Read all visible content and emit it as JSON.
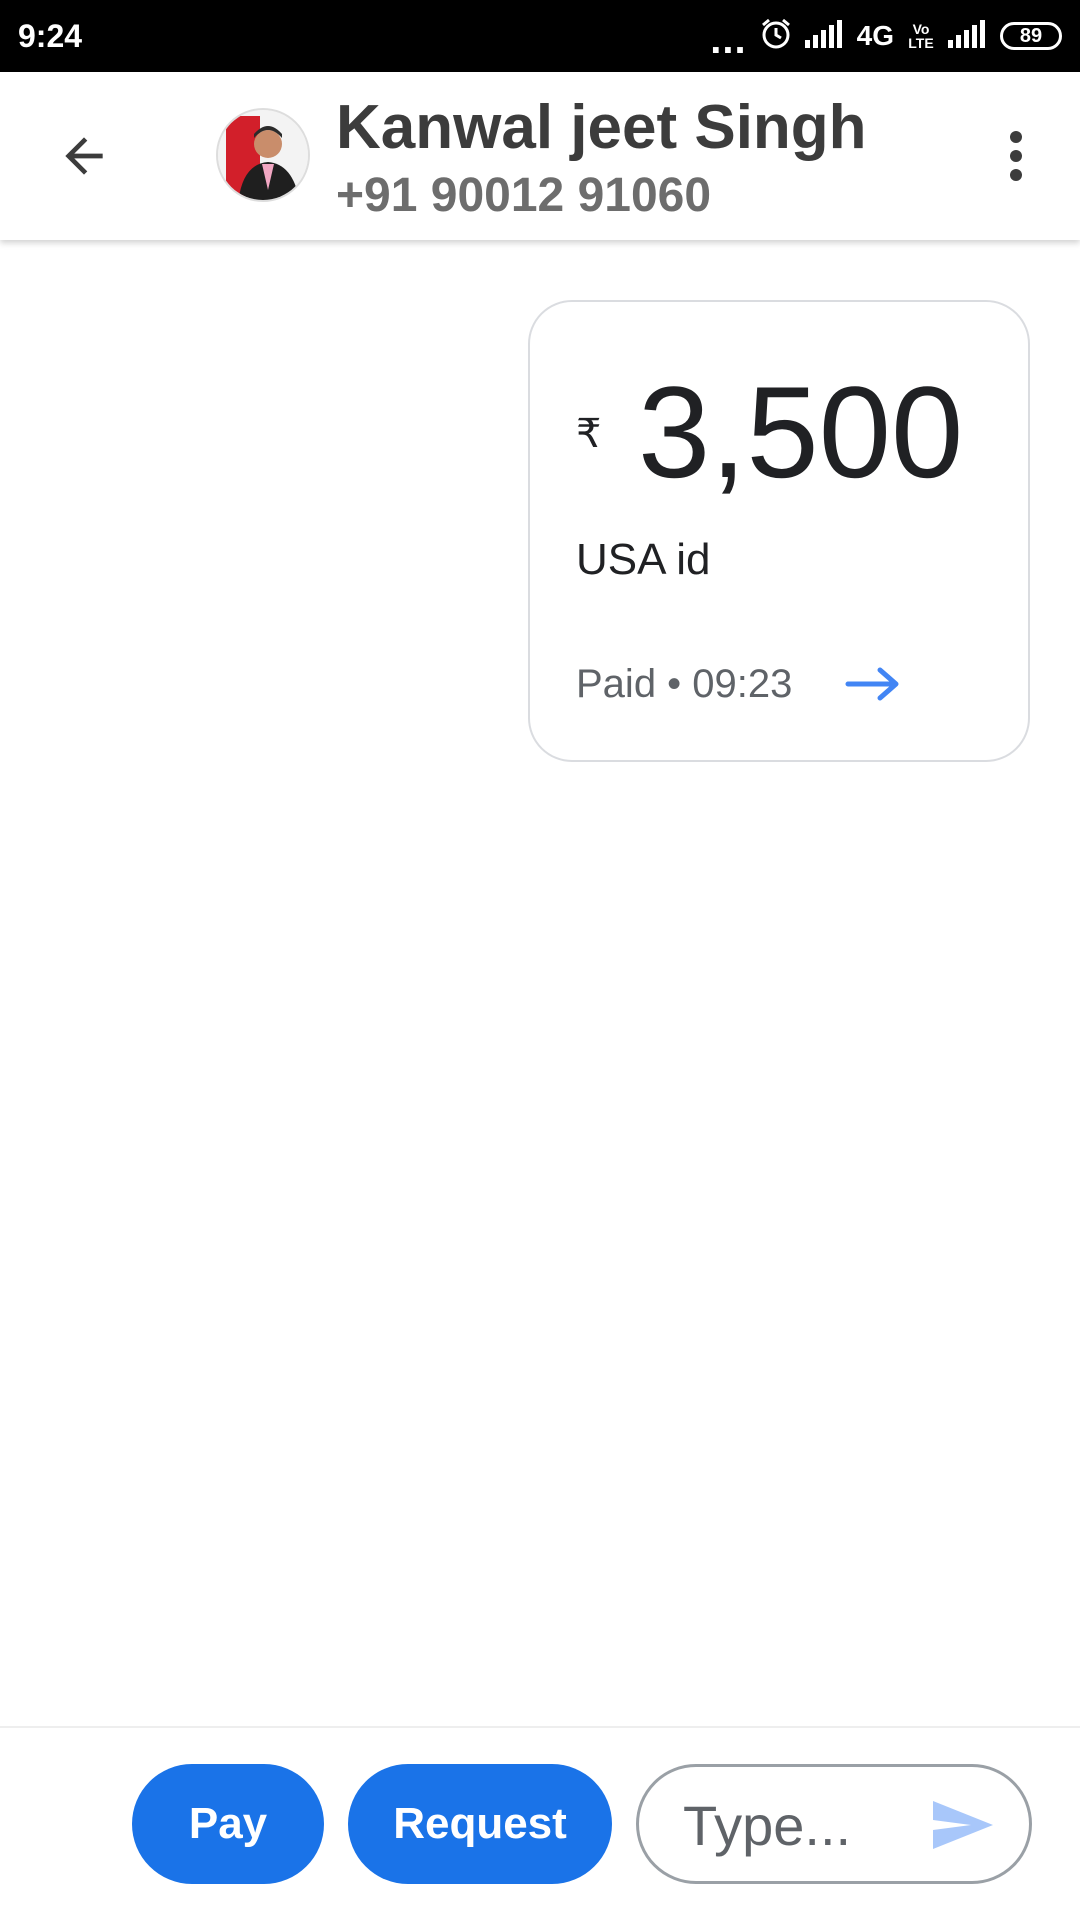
{
  "status_bar": {
    "time": "9:24",
    "dots": "...",
    "network": "4G",
    "volte": "Vo LTE",
    "battery": "89"
  },
  "header": {
    "contact_name": "Kanwal jeet Singh",
    "contact_phone": "+91 90012 91060"
  },
  "payment": {
    "currency_symbol": "₹",
    "amount": "3,500",
    "note": "USA id",
    "status": "Paid • 09:23"
  },
  "footer": {
    "pay_label": "Pay",
    "request_label": "Request",
    "type_placeholder": "Type..."
  },
  "colors": {
    "primary_blue": "#1a73e8",
    "arrow_blue": "#4285f4",
    "send_icon": "#a8c7fa"
  },
  "icons": {
    "back": "arrow-back-icon",
    "more": "more-vert-icon",
    "send": "send-icon",
    "status_arrow": "arrow-forward-icon"
  }
}
